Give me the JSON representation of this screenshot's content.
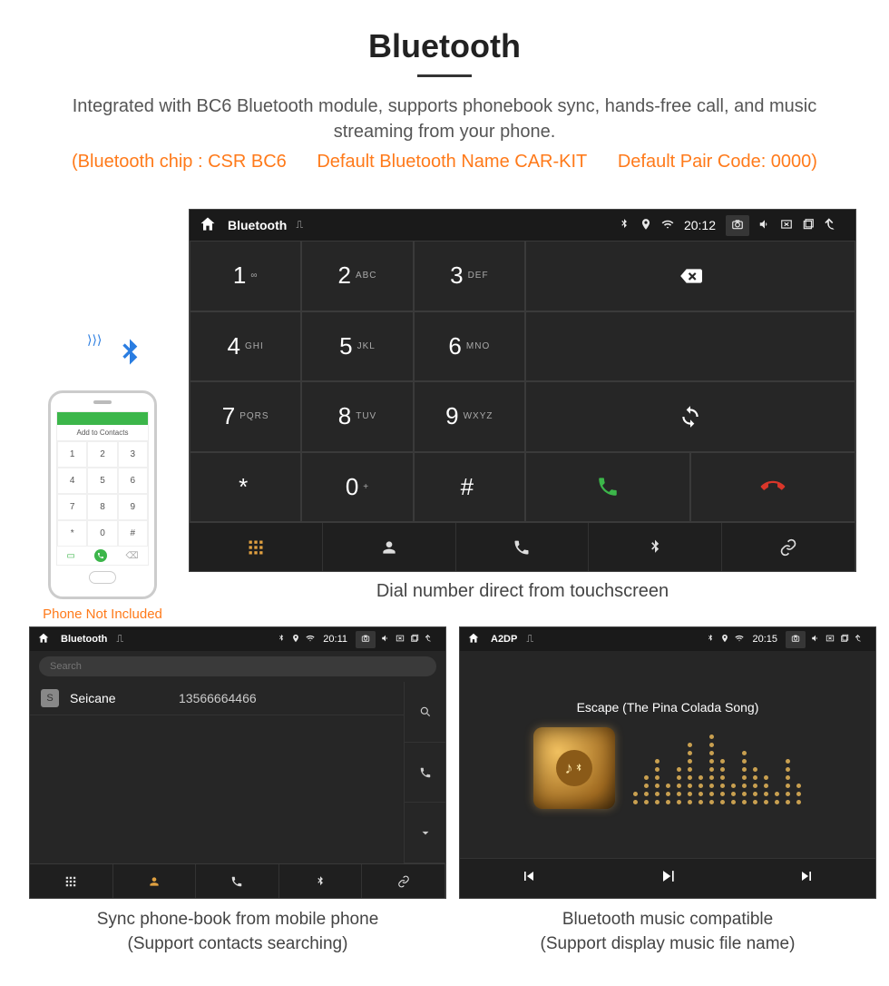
{
  "header": {
    "title": "Bluetooth",
    "description": "Integrated with BC6 Bluetooth module, supports phonebook sync, hands-free call, and music streaming from your phone.",
    "spec_chip": "(Bluetooth chip : CSR BC6",
    "spec_name": "Default Bluetooth Name CAR-KIT",
    "spec_code": "Default Pair Code: 0000)"
  },
  "phone_illus": {
    "add_contacts": "Add to Contacts",
    "keys": [
      "1",
      "2",
      "3",
      "4",
      "5",
      "6",
      "7",
      "8",
      "9",
      "*",
      "0",
      "#"
    ],
    "caption": "Phone Not Included"
  },
  "dialer": {
    "status": {
      "title": "Bluetooth",
      "clock": "20:12"
    },
    "keys": [
      {
        "d": "1",
        "l": "∞"
      },
      {
        "d": "2",
        "l": "ABC"
      },
      {
        "d": "3",
        "l": "DEF"
      },
      {
        "d": "4",
        "l": "GHI"
      },
      {
        "d": "5",
        "l": "JKL"
      },
      {
        "d": "6",
        "l": "MNO"
      },
      {
        "d": "7",
        "l": "PQRS"
      },
      {
        "d": "8",
        "l": "TUV"
      },
      {
        "d": "9",
        "l": "WXYZ"
      },
      {
        "d": "*",
        "l": ""
      },
      {
        "d": "0",
        "l": "+"
      },
      {
        "d": "#",
        "l": ""
      }
    ],
    "caption": "Dial number direct from touchscreen"
  },
  "contacts": {
    "status": {
      "title": "Bluetooth",
      "clock": "20:11"
    },
    "search_placeholder": "Search",
    "list": [
      {
        "initial": "S",
        "name": "Seicane",
        "number": "13566664466"
      }
    ],
    "caption_l1": "Sync phone-book from mobile phone",
    "caption_l2": "(Support contacts searching)"
  },
  "music": {
    "status": {
      "title": "A2DP",
      "clock": "20:15"
    },
    "track": "Escape (The Pina Colada Song)",
    "eq_heights": [
      2,
      4,
      6,
      3,
      5,
      8,
      4,
      9,
      6,
      3,
      7,
      5,
      4,
      2,
      6,
      3
    ],
    "caption_l1": "Bluetooth music compatible",
    "caption_l2": "(Support display music file name)"
  }
}
